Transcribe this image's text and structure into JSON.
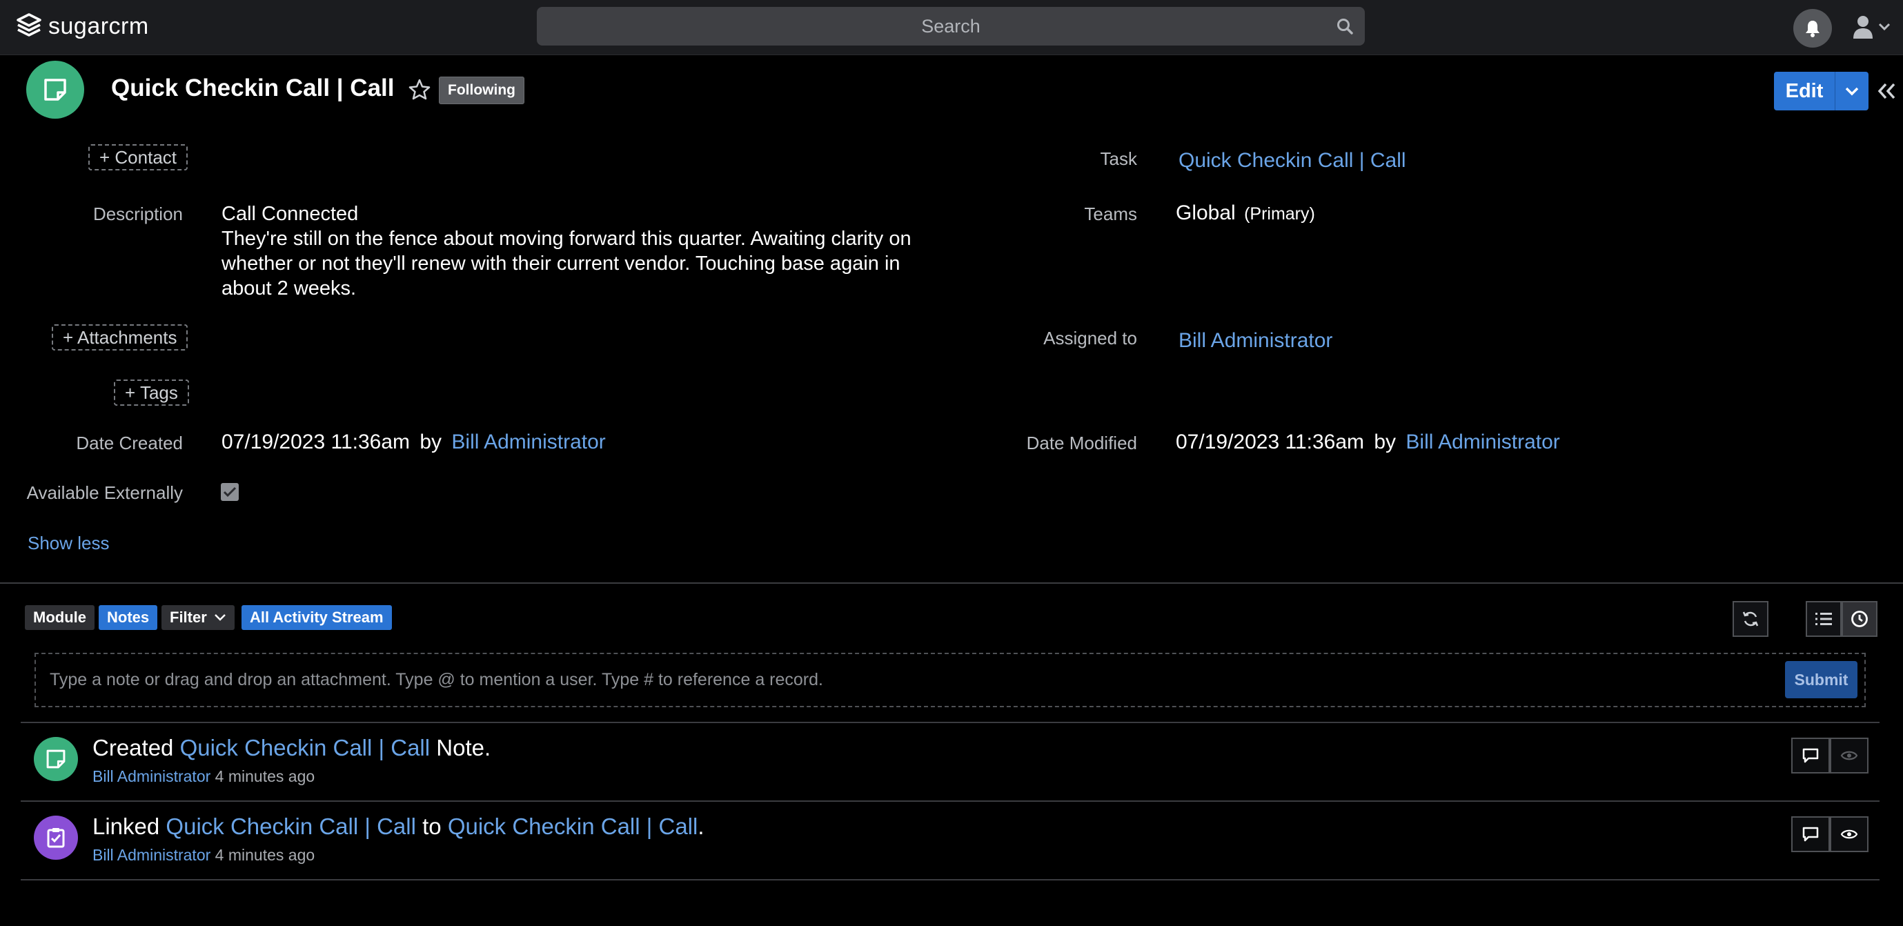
{
  "topbar": {
    "logo_text": "sugarcrm",
    "search_placeholder": "Search"
  },
  "record": {
    "title": "Quick Checkin Call | Call",
    "following_label": "Following",
    "edit_label": "Edit",
    "icon": "note-icon"
  },
  "fields": {
    "contact_button": "+ Contact",
    "description_label": "Description",
    "description_value": "Call Connected\nThey're still on the fence about moving forward this quarter. Awaiting clarity on whether or not they'll renew with their current vendor. Touching base again in about 2 weeks.",
    "attachments_button": "+ Attachments",
    "tags_button": "+ Tags",
    "date_created_label": "Date Created",
    "date_created_value": "07/19/2023 11:36am",
    "date_created_by": "by",
    "date_created_user": "Bill Administrator",
    "available_externally_label": "Available Externally",
    "available_externally_checked": true,
    "show_less": "Show less",
    "task_label": "Task",
    "task_value": "Quick Checkin Call | Call",
    "teams_label": "Teams",
    "teams_value": "Global",
    "teams_primary": "(Primary)",
    "assigned_label": "Assigned to",
    "assigned_value": "Bill Administrator",
    "date_modified_label": "Date Modified",
    "date_modified_value": "07/19/2023 11:36am",
    "date_modified_by": "by",
    "date_modified_user": "Bill Administrator"
  },
  "activity": {
    "module_pill": "Module",
    "notes_pill": "Notes",
    "filter_label": "Filter",
    "stream_pill": "All Activity Stream",
    "composer_placeholder": "Type a note or drag and drop an attachment. Type @ to mention a user. Type # to reference a record.",
    "submit_label": "Submit",
    "items": [
      {
        "verb": "Created",
        "link1": "Quick Checkin Call | Call",
        "suffix": "Note.",
        "user": "Bill Administrator",
        "time": "4 minutes ago",
        "icon_color": "#3ab07d",
        "icon": "note-icon"
      },
      {
        "verb": "Linked",
        "link1": "Quick Checkin Call | Call",
        "mid": "to",
        "link2": "Quick Checkin Call | Call",
        "suffix": ".",
        "user": "Bill Administrator",
        "time": "4 minutes ago",
        "icon_color": "#8a4fd6",
        "icon": "task-icon"
      }
    ]
  },
  "colors": {
    "accent": "#2a74d4",
    "link": "#6ba5e8",
    "note_green": "#3ab07d",
    "task_purple": "#8a4fd6"
  }
}
